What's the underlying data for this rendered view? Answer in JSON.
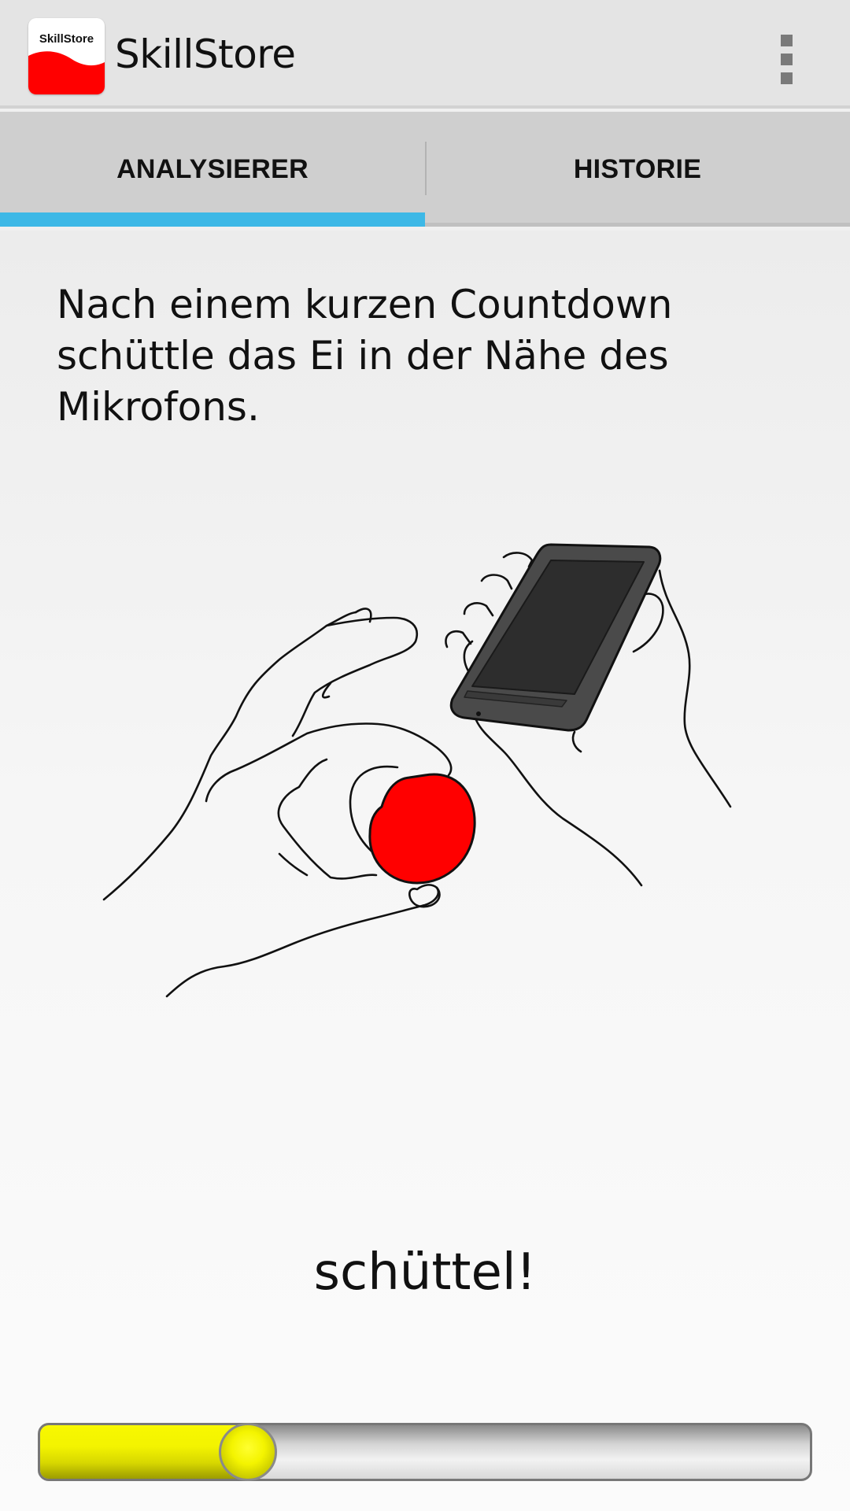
{
  "app": {
    "title": "SkillStore",
    "logo_text": "SkillStore",
    "logo_color": "#ff0000",
    "overflow_icon": "overflow-menu-icon"
  },
  "tabs": [
    {
      "label": "ANALYSIERER",
      "selected": true
    },
    {
      "label": "HISTORIE",
      "selected": false
    }
  ],
  "colors": {
    "tab_indicator": "#3db8e6",
    "egg": "#ff0000",
    "progress_fill": "#f3f300"
  },
  "main": {
    "instructions": "Nach einem kurzen Countdown schüttle das Ei in der Nähe des Mikrofons.",
    "illustration": "hands-shaking-egg-near-phone-illustration",
    "status": "schüttel!"
  },
  "progress": {
    "fraction": 0.27
  }
}
